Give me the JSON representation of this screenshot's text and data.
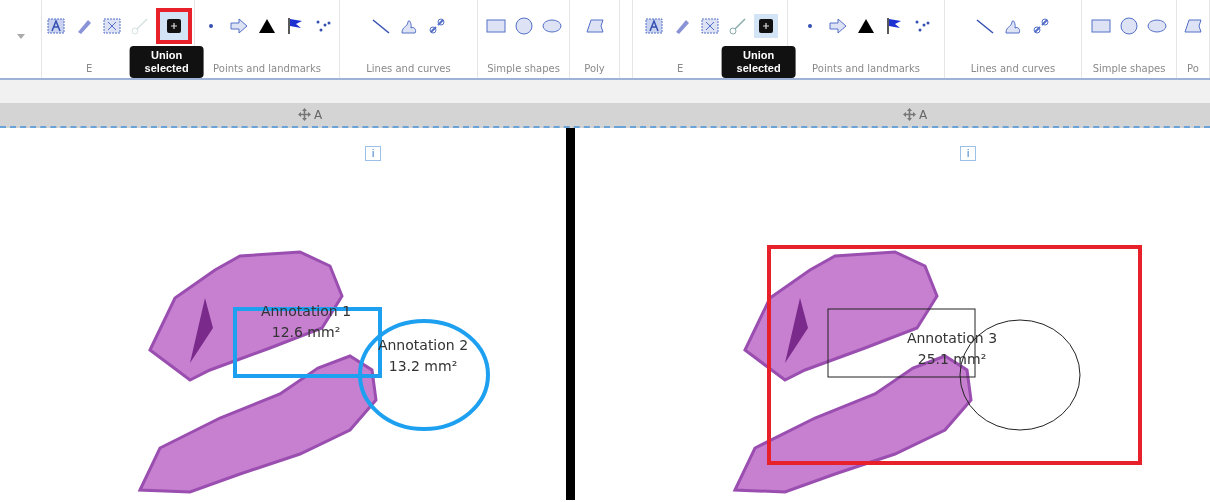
{
  "panels": [
    {
      "toolbar": {
        "groups": [
          {
            "label": "E",
            "tools": [
              {
                "kind": "text-box",
                "selected": false,
                "disabled": false,
                "highlighted": false
              },
              {
                "kind": "pencil",
                "selected": false,
                "disabled": false,
                "highlighted": false
              },
              {
                "kind": "dashed-x",
                "selected": false,
                "disabled": false,
                "highlighted": false
              },
              {
                "kind": "brush",
                "selected": false,
                "disabled": true,
                "highlighted": false
              },
              {
                "kind": "union",
                "selected": true,
                "disabled": false,
                "highlighted": true,
                "tooltip": "Union selected"
              }
            ]
          },
          {
            "label": "Points and landmarks",
            "tools": [
              {
                "kind": "point",
                "selected": false,
                "disabled": false,
                "highlighted": false
              },
              {
                "kind": "arrow",
                "selected": false,
                "disabled": false,
                "highlighted": false
              },
              {
                "kind": "triangle",
                "selected": false,
                "disabled": false,
                "highlighted": false
              },
              {
                "kind": "flag",
                "selected": false,
                "disabled": false,
                "highlighted": false
              },
              {
                "kind": "scatter",
                "selected": false,
                "disabled": false,
                "highlighted": false
              }
            ]
          },
          {
            "label": "Lines and curves",
            "tools": [
              {
                "kind": "line",
                "selected": false,
                "disabled": false,
                "highlighted": false
              },
              {
                "kind": "freehand",
                "selected": false,
                "disabled": false,
                "highlighted": false
              },
              {
                "kind": "link",
                "selected": false,
                "disabled": false,
                "highlighted": false
              }
            ]
          },
          {
            "label": "Simple shapes",
            "tools": [
              {
                "kind": "rect",
                "selected": false,
                "disabled": false,
                "highlighted": false
              },
              {
                "kind": "circle",
                "selected": false,
                "disabled": false,
                "highlighted": false
              },
              {
                "kind": "ellipse",
                "selected": false,
                "disabled": false,
                "highlighted": false
              }
            ]
          },
          {
            "label": "Poly",
            "tools": [
              {
                "kind": "polygon",
                "selected": false,
                "disabled": false,
                "highlighted": false
              }
            ]
          }
        ]
      },
      "header": "A",
      "info": "i",
      "highlighted": false,
      "annotations": [
        {
          "kind": "rectangle",
          "label": "Annotation 1",
          "area": "12.6 mm²",
          "selected": true
        },
        {
          "kind": "ellipse",
          "label": "Annotation 2",
          "area": "13.2 mm²",
          "selected": true
        }
      ]
    },
    {
      "toolbar": {
        "groups": [
          {
            "label": "E",
            "tools": [
              {
                "kind": "text-box",
                "selected": false,
                "disabled": false,
                "highlighted": false
              },
              {
                "kind": "pencil",
                "selected": false,
                "disabled": false,
                "highlighted": false
              },
              {
                "kind": "dashed-x",
                "selected": false,
                "disabled": false,
                "highlighted": false
              },
              {
                "kind": "brush",
                "selected": false,
                "disabled": false,
                "highlighted": false
              },
              {
                "kind": "union",
                "selected": true,
                "disabled": false,
                "highlighted": false,
                "tooltip": "Union selected"
              }
            ]
          },
          {
            "label": "Points and landmarks",
            "tools": [
              {
                "kind": "point",
                "selected": false,
                "disabled": false,
                "highlighted": false
              },
              {
                "kind": "arrow",
                "selected": false,
                "disabled": false,
                "highlighted": false
              },
              {
                "kind": "triangle",
                "selected": false,
                "disabled": false,
                "highlighted": false
              },
              {
                "kind": "flag",
                "selected": false,
                "disabled": false,
                "highlighted": false
              },
              {
                "kind": "scatter",
                "selected": false,
                "disabled": false,
                "highlighted": false
              }
            ]
          },
          {
            "label": "Lines and curves",
            "tools": [
              {
                "kind": "line",
                "selected": false,
                "disabled": false,
                "highlighted": false
              },
              {
                "kind": "freehand",
                "selected": false,
                "disabled": false,
                "highlighted": false
              },
              {
                "kind": "link",
                "selected": false,
                "disabled": false,
                "highlighted": false
              }
            ]
          },
          {
            "label": "Simple shapes",
            "tools": [
              {
                "kind": "rect",
                "selected": false,
                "disabled": false,
                "highlighted": false
              },
              {
                "kind": "circle",
                "selected": false,
                "disabled": false,
                "highlighted": false
              },
              {
                "kind": "ellipse",
                "selected": false,
                "disabled": false,
                "highlighted": false
              }
            ]
          },
          {
            "label": "Po",
            "tools": [
              {
                "kind": "polygon",
                "selected": false,
                "disabled": false,
                "highlighted": false
              }
            ]
          }
        ]
      },
      "header": "A",
      "info": "i",
      "highlighted": true,
      "annotations": [
        {
          "kind": "union",
          "label": "Annotation 3",
          "area": "25.1 mm²",
          "selected": false
        }
      ]
    }
  ]
}
